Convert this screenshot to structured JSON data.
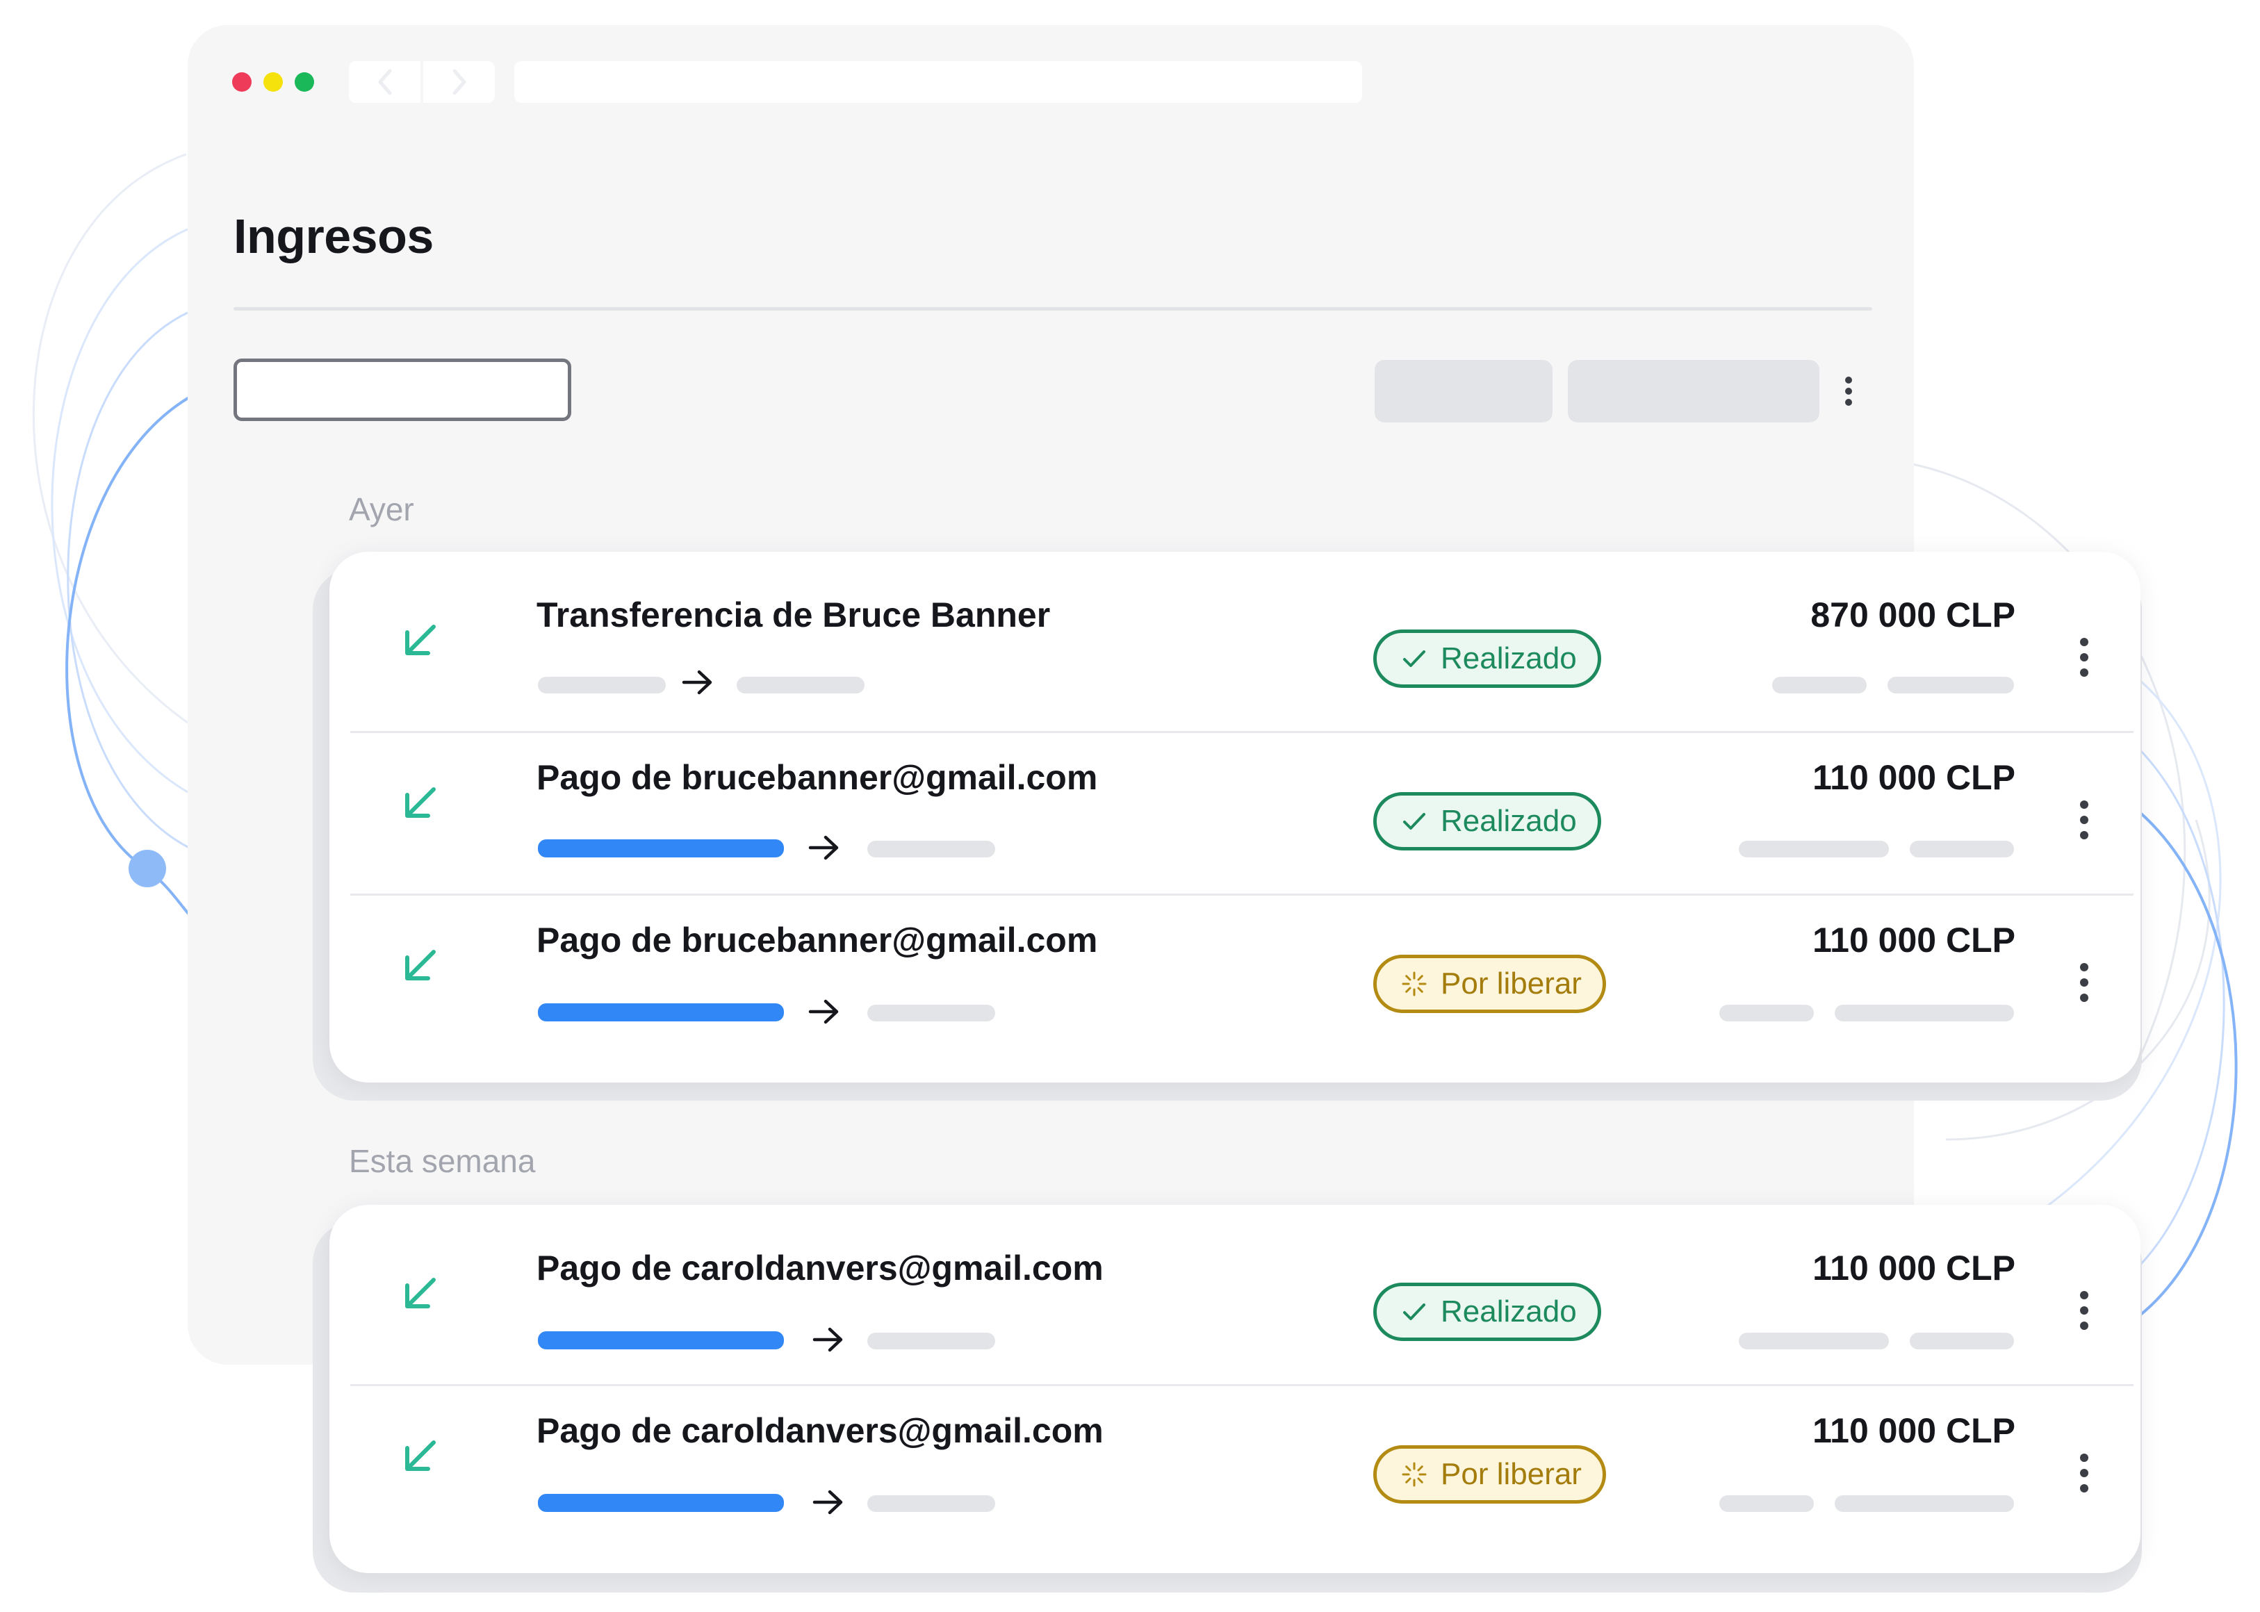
{
  "colors": {
    "accent_blue": "#3187f5",
    "success": "#1d8a5e",
    "pending": "#a37c0b",
    "incoming_icon": "#2bb894",
    "window_dot_red": "#ef3b5a",
    "window_dot_yellow": "#f5e20c",
    "window_dot_green": "#1bb85a"
  },
  "browser": {
    "window_controls": [
      "close",
      "minimize",
      "maximize"
    ],
    "nav_icons": [
      "chevron-left-icon",
      "chevron-right-icon"
    ],
    "url": ""
  },
  "page": {
    "title": "Ingresos"
  },
  "toolbar": {
    "search_placeholder": "",
    "search_icon": "search-icon",
    "more_icon": "more-vertical-icon"
  },
  "groups": [
    {
      "label": "Ayer",
      "rows": [
        {
          "title": "Transferencia de Bruce Banner",
          "icon": "arrow-down-left-icon",
          "status": {
            "label": "Realizado",
            "icon": "check-icon",
            "kind": "done"
          },
          "amount": "870 000 CLP"
        },
        {
          "title": "Pago de brucebanner@gmail.com",
          "icon": "arrow-down-left-icon",
          "status": {
            "label": "Realizado",
            "icon": "check-icon",
            "kind": "done"
          },
          "amount": "110 000 CLP"
        },
        {
          "title": "Pago de brucebanner@gmail.com",
          "icon": "arrow-down-left-icon",
          "status": {
            "label": "Por liberar",
            "icon": "loading-icon",
            "kind": "pending"
          },
          "amount": "110 000 CLP"
        }
      ]
    },
    {
      "label": "Esta semana",
      "rows": [
        {
          "title": "Pago de caroldanvers@gmail.com",
          "icon": "arrow-down-left-icon",
          "status": {
            "label": "Realizado",
            "icon": "check-icon",
            "kind": "done"
          },
          "amount": "110 000 CLP"
        },
        {
          "title": "Pago de caroldanvers@gmail.com",
          "icon": "arrow-down-left-icon",
          "status": {
            "label": "Por liberar",
            "icon": "loading-icon",
            "kind": "pending"
          },
          "amount": "110 000 CLP"
        }
      ]
    }
  ]
}
